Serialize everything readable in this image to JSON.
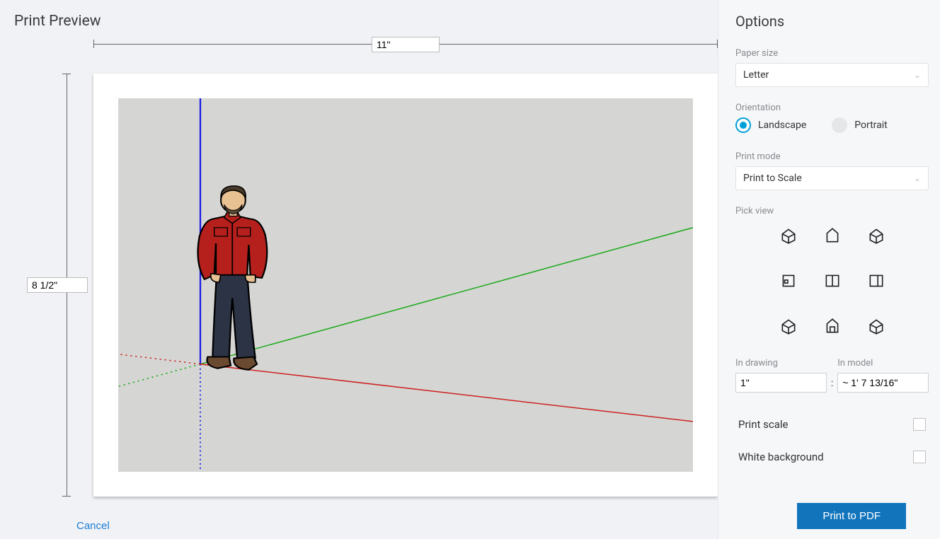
{
  "header": {
    "title": "Print Preview"
  },
  "rulers": {
    "width_label": "11\"",
    "height_label": "8 1/2\""
  },
  "footer": {
    "cancel": "Cancel",
    "print": "Print to PDF"
  },
  "options": {
    "title": "Options",
    "paper_size": {
      "label": "Paper size",
      "value": "Letter"
    },
    "orientation": {
      "label": "Orientation",
      "landscape": "Landscape",
      "portrait": "Portrait",
      "selected": "landscape"
    },
    "print_mode": {
      "label": "Print mode",
      "value": "Print to Scale"
    },
    "pick_view_label": "Pick view",
    "views": [
      "iso",
      "top",
      "iso-right",
      "front",
      "front-ortho",
      "right",
      "iso-back-left",
      "back",
      "iso-back-right"
    ],
    "scale": {
      "in_drawing_label": "In drawing",
      "in_drawing_value": "1\"",
      "in_model_label": "In model",
      "in_model_value": "~ 1' 7 13/16\""
    },
    "print_scale_label": "Print scale",
    "white_bg_label": "White background"
  }
}
